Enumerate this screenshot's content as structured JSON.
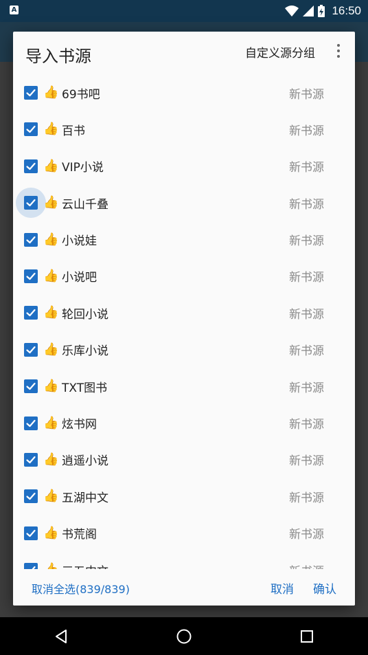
{
  "status_bar": {
    "left_icon": "A",
    "time": "16:50",
    "icons": [
      "wifi-icon",
      "signal-icon",
      "battery-charging-icon"
    ]
  },
  "dialog": {
    "title": "导入书源",
    "group_button": "自定义源分组",
    "more_icon": "more-vert-icon",
    "item_icon": "👍",
    "items": [
      {
        "name": "69书吧",
        "group": "新书源",
        "checked": true
      },
      {
        "name": "百书",
        "group": "新书源",
        "checked": true
      },
      {
        "name": "VIP小说",
        "group": "新书源",
        "checked": true
      },
      {
        "name": "云山千叠",
        "group": "新书源",
        "checked": true
      },
      {
        "name": "小说娃",
        "group": "新书源",
        "checked": true
      },
      {
        "name": "小说吧",
        "group": "新书源",
        "checked": true
      },
      {
        "name": "轮回小说",
        "group": "新书源",
        "checked": true
      },
      {
        "name": "乐库小说",
        "group": "新书源",
        "checked": true
      },
      {
        "name": "TXT图书",
        "group": "新书源",
        "checked": true
      },
      {
        "name": "炫书网",
        "group": "新书源",
        "checked": true
      },
      {
        "name": "逍遥小说",
        "group": "新书源",
        "checked": true
      },
      {
        "name": "五湖中文",
        "group": "新书源",
        "checked": true
      },
      {
        "name": "书荒阁",
        "group": "新书源",
        "checked": true
      },
      {
        "name": "三五中文",
        "group": "新书源",
        "checked": true
      }
    ],
    "footer": {
      "select_all": "取消全选(839/839)",
      "cancel": "取消",
      "confirm": "确认"
    }
  },
  "nav_bar": {
    "back_icon": "back-triangle-icon",
    "home_icon": "home-circle-icon",
    "recents_icon": "recents-square-icon"
  },
  "colors": {
    "accent": "#1f6fc4",
    "status_bar": "#12364f"
  }
}
